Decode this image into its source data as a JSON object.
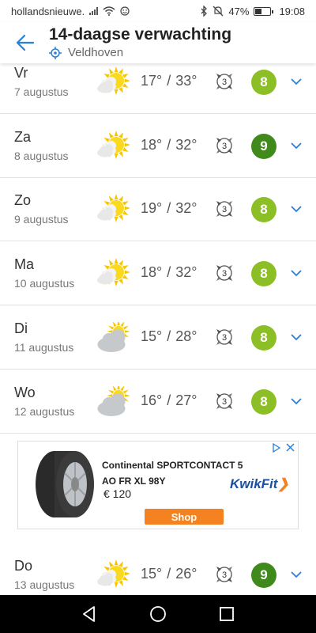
{
  "status_bar": {
    "app": "hollandsnieuwe.",
    "battery": "47%",
    "battery_level": 0.47,
    "time": "19:08",
    "icons": [
      "signal-icon",
      "wifi-icon",
      "smiley-icon",
      "bluetooth-icon",
      "mute-icon",
      "battery-icon"
    ]
  },
  "header": {
    "title": "14-daagse verwachting",
    "location": "Veldhoven",
    "icons": [
      "back-arrow-icon",
      "location-target-icon"
    ]
  },
  "days": [
    {
      "day": "Vr",
      "date": "7 augustus",
      "min": "17°",
      "max": "33°",
      "wind": "3",
      "score": "8",
      "score_color": "#8cbf26",
      "weather": "sunny-icon"
    },
    {
      "day": "Za",
      "date": "8 augustus",
      "min": "18°",
      "max": "32°",
      "wind": "3",
      "score": "9",
      "score_color": "#3f8a1a",
      "weather": "sunny-icon"
    },
    {
      "day": "Zo",
      "date": "9 augustus",
      "min": "19°",
      "max": "32°",
      "wind": "3",
      "score": "8",
      "score_color": "#8cbf26",
      "weather": "sunny-icon"
    },
    {
      "day": "Ma",
      "date": "10 augustus",
      "min": "18°",
      "max": "32°",
      "wind": "3",
      "score": "8",
      "score_color": "#8cbf26",
      "weather": "sunny-icon"
    },
    {
      "day": "Di",
      "date": "11 augustus",
      "min": "15°",
      "max": "28°",
      "wind": "3",
      "score": "8",
      "score_color": "#8cbf26",
      "weather": "partly-cloudy-icon"
    },
    {
      "day": "Wo",
      "date": "12 augustus",
      "min": "16°",
      "max": "27°",
      "wind": "3",
      "score": "8",
      "score_color": "#8cbf26",
      "weather": "partly-cloudy-icon"
    },
    {
      "day": "Do",
      "date": "13 augustus",
      "min": "15°",
      "max": "26°",
      "wind": "3",
      "score": "9",
      "score_color": "#3f8a1a",
      "weather": "sunny-icon"
    }
  ],
  "separator": "/",
  "ad": {
    "title": "Continental SPORTCONTACT 5 AO FR XL 98Y",
    "price": "€ 120",
    "button": "Shop",
    "brand": "KwikFit",
    "icons": [
      "adchoices-icon",
      "ad-close-icon",
      "tire-image"
    ]
  },
  "nav_bar": {
    "icons": [
      "back-triangle-icon",
      "home-circle-icon",
      "recents-square-icon"
    ]
  }
}
